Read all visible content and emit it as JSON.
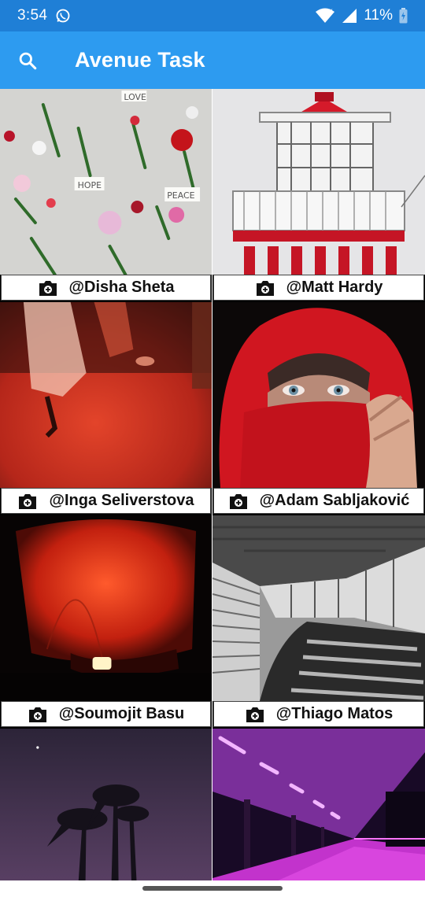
{
  "status_bar": {
    "time": "3:54",
    "battery": "11%",
    "icons": [
      "whatsapp-icon",
      "wifi-icon",
      "signal-icon",
      "battery-icon"
    ]
  },
  "app_bar": {
    "title": "Avenue Task",
    "search_icon": "search-icon",
    "background": "#2d9bf0"
  },
  "photos": [
    {
      "author": "@Disha Sheta",
      "icon": "camera-icon"
    },
    {
      "author": "@Matt Hardy",
      "icon": "camera-icon"
    },
    {
      "author": "@Inga Seliverstova",
      "icon": "camera-icon"
    },
    {
      "author": "@Adam Sabljaković",
      "icon": "camera-icon"
    },
    {
      "author": "@Soumojit Basu",
      "icon": "camera-icon"
    },
    {
      "author": "@Thiago  Matos",
      "icon": "camera-icon"
    },
    {
      "author": "",
      "icon": "camera-icon"
    },
    {
      "author": "",
      "icon": "camera-icon"
    }
  ],
  "flowers_notes": [
    "LOVE",
    "HOPE",
    "PEACE"
  ]
}
